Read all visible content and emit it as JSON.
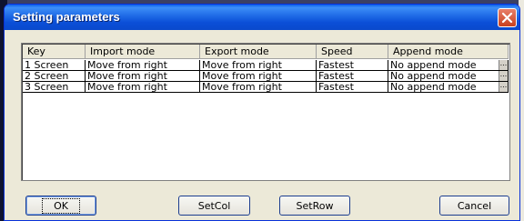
{
  "dialog": {
    "title": "Setting parameters"
  },
  "table": {
    "headers": [
      "Key",
      "Import mode",
      "Export mode",
      "Speed",
      "Append mode"
    ],
    "rows": [
      [
        "1 Screen",
        "Move from right",
        "Move from right",
        "Fastest",
        "No append mode"
      ],
      [
        "2 Screen",
        "Move from right",
        "Move from right",
        "Fastest",
        "No append mode"
      ],
      [
        "3 Screen",
        "Move from right",
        "Move from right",
        "Fastest",
        "No append mode"
      ]
    ],
    "ellipsis": "..."
  },
  "buttons": {
    "ok": "OK",
    "setcol": "SetCol",
    "setrow": "SetRow",
    "cancel": "Cancel"
  },
  "colors": {
    "titlebar": "#0a5ee8",
    "dialog_bg": "#ece9d8",
    "close": "#c8401e"
  }
}
